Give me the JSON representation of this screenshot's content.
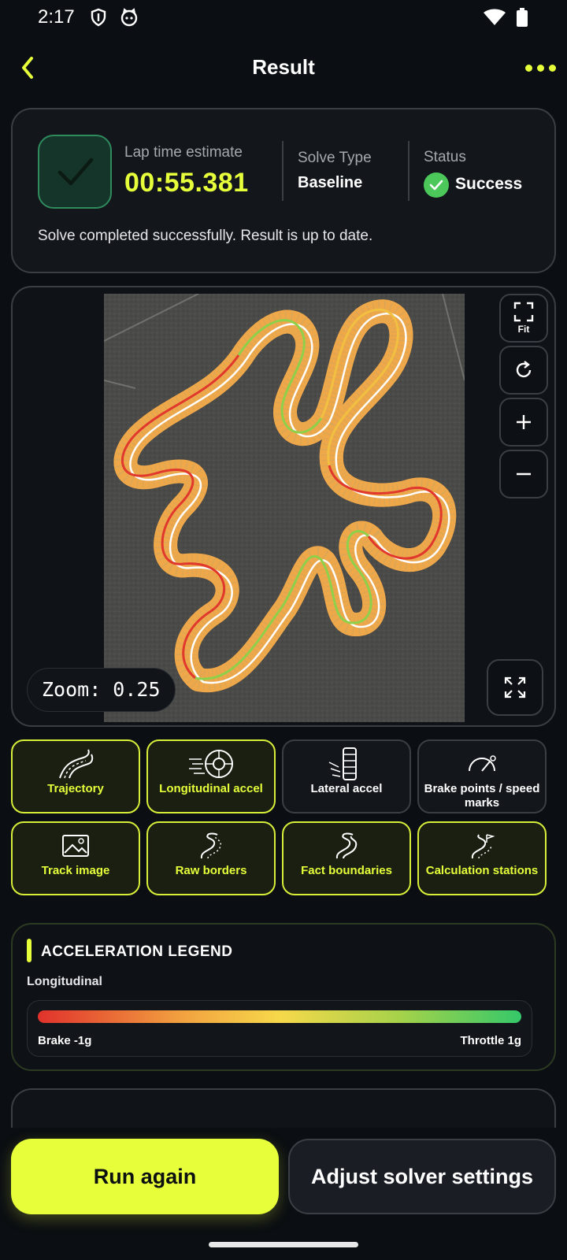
{
  "status_bar": {
    "time": "2:17"
  },
  "header": {
    "title": "Result"
  },
  "summary": {
    "lap_label": "Lap time estimate",
    "lap_value": "00:55.381",
    "solve_type_label": "Solve Type",
    "solve_type_value": "Baseline",
    "status_label": "Status",
    "status_value": "Success",
    "note": "Solve completed successfully. Result is up to date."
  },
  "map": {
    "fit_label": "Fit",
    "zoom_text": "Zoom: 0.25"
  },
  "layers": [
    {
      "label": "Trajectory",
      "active": true,
      "icon": "road-curve-icon"
    },
    {
      "label": "Longitudinal accel",
      "active": true,
      "icon": "tire-speed-icon"
    },
    {
      "label": "Lateral accel",
      "active": false,
      "icon": "tire-lateral-icon"
    },
    {
      "label": "Brake points / speed marks",
      "active": false,
      "icon": "gauge-icon"
    },
    {
      "label": "Track image",
      "active": true,
      "icon": "image-icon"
    },
    {
      "label": "Raw borders",
      "active": true,
      "icon": "path-icon"
    },
    {
      "label": "Fact boundaries",
      "active": true,
      "icon": "path-icon"
    },
    {
      "label": "Calculation stations",
      "active": true,
      "icon": "path-flag-icon"
    }
  ],
  "legend": {
    "title": "ACCELERATION LEGEND",
    "subtitle": "Longitudinal",
    "min_label": "Brake -1g",
    "max_label": "Throttle 1g"
  },
  "actions": {
    "run_again": "Run again",
    "adjust": "Adjust solver settings"
  },
  "colors": {
    "accent": "#e6ff3a",
    "success": "#4cc85a",
    "background": "#0b0e12"
  }
}
